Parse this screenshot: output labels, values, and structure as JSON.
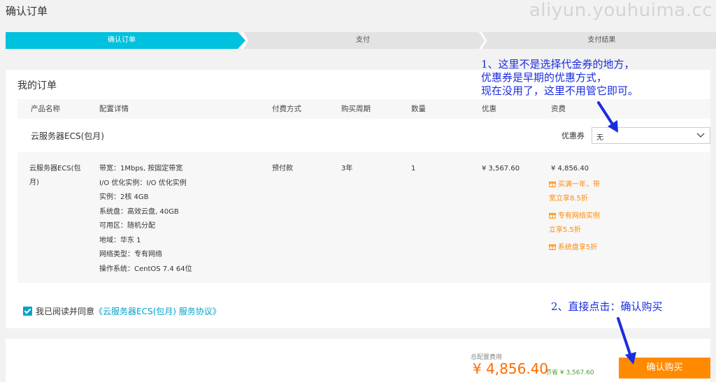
{
  "page": {
    "title": "确认订单",
    "watermark": "aliyun.youhuima.cc"
  },
  "steps": [
    "确认订单",
    "支付",
    "支付结果"
  ],
  "order": {
    "title": "我的订单",
    "columns": [
      "产品名称",
      "配置详情",
      "付费方式",
      "购买周期",
      "数量",
      "优惠",
      "资费"
    ],
    "product_name": "云服务器ECS(包月)",
    "coupon_label": "优惠券",
    "coupon_value": "无",
    "row": {
      "name": "云服务器ECS(包月)",
      "specs": [
        "带宽：1Mbps, 按固定带宽",
        "I/O 优化实例：I/O 优化实例",
        "实例：2核 4GB",
        "系统盘：高效云盘, 40GB",
        "可用区：随机分配",
        "地域：华东 1",
        "网络类型：专有网络",
        "操作系统：CentOS 7.4 64位"
      ],
      "payment": "预付款",
      "period": "3年",
      "quantity": "1",
      "discount": "¥ 3,567.60",
      "price": "¥ 4,856.40",
      "promos": [
        [
          "买满一年，带",
          "宽立享8.5折"
        ],
        [
          "专有网络实例",
          "立享5.5折"
        ],
        [
          "系统盘享5折"
        ]
      ]
    },
    "agreement_prefix": "我已阅读并同意",
    "agreement_link": "《云服务器ECS(包月) 服务协议》"
  },
  "footer": {
    "total_label": "总配置费用",
    "total_amount": "¥ 4,856.40",
    "save_text": "节省 ¥ 3,567.60",
    "buy_label": "确认购买"
  },
  "annotations": {
    "note1": [
      "1、这里不是选择代金券的地方，",
      "优惠券是早期的优惠方式，",
      "现在没用了，这里不用管它即可。"
    ],
    "note2": "2、直接点击：确认购买"
  },
  "colors": {
    "accent": "#00c1de",
    "orange": "#ff8a00",
    "annotation": "#1a2ce0"
  }
}
